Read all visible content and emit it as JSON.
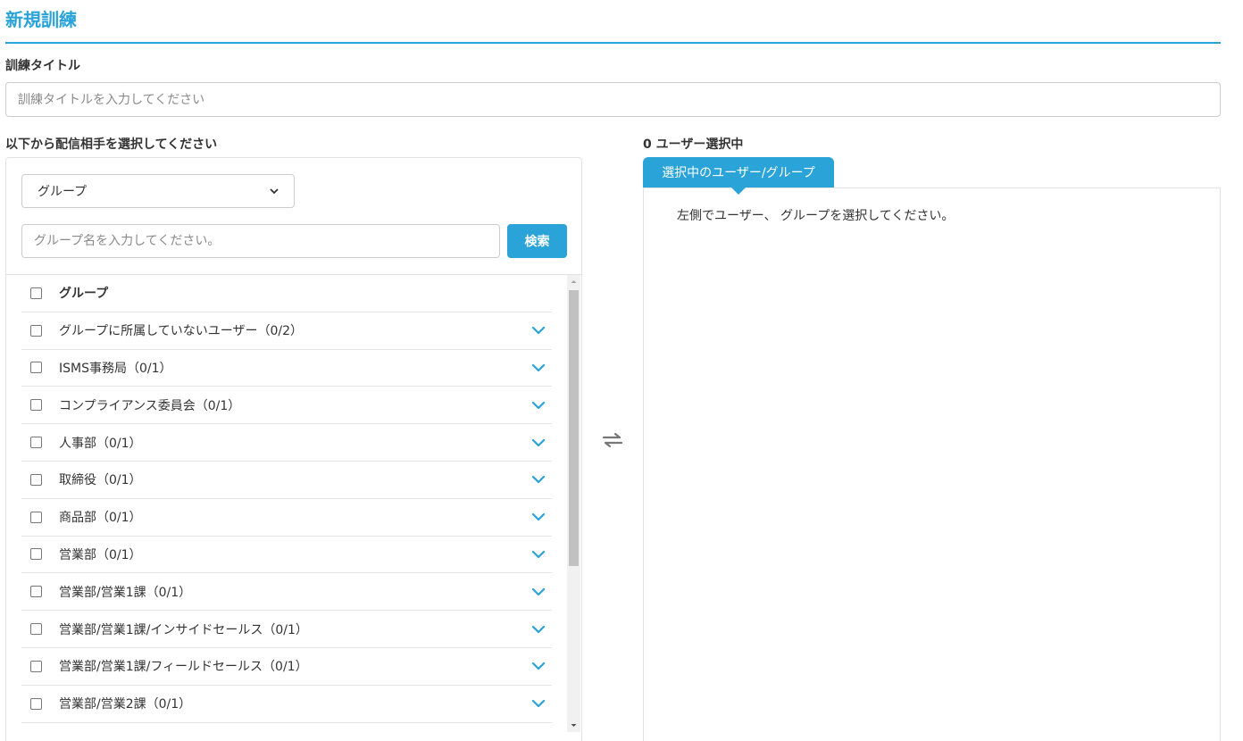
{
  "page": {
    "title": "新規訓練"
  },
  "title_field": {
    "label": "訓練タイトル",
    "placeholder": "訓練タイトルを入力してください"
  },
  "recipients": {
    "heading": "以下から配信相手を選択してください",
    "type_select": {
      "selected": "グループ"
    },
    "search": {
      "placeholder": "グループ名を入力してください。",
      "button_label": "検索"
    },
    "list_header": "グループ",
    "groups": [
      {
        "label": "グループに所属していないユーザー（0/2）"
      },
      {
        "label": "ISMS事務局（0/1）"
      },
      {
        "label": "コンプライアンス委員会（0/1）"
      },
      {
        "label": "人事部（0/1）"
      },
      {
        "label": "取締役（0/1）"
      },
      {
        "label": "商品部（0/1）"
      },
      {
        "label": "営業部（0/1）"
      },
      {
        "label": "営業部/営業1課（0/1）"
      },
      {
        "label": "営業部/営業1課/インサイドセールス（0/1）"
      },
      {
        "label": "営業部/営業1課/フィールドセールス（0/1）"
      },
      {
        "label": "営業部/営業2課（0/1）"
      }
    ]
  },
  "selection": {
    "count_text": "0 ユーザー選択中",
    "tab_label": "選択中のユーザー/グループ",
    "empty_message": "左側でユーザー、 グループを選択してください。"
  },
  "icons": {
    "swap": "swap-arrows-icon",
    "expand": "chevron-down-icon"
  },
  "colors": {
    "accent": "#2aa3d8"
  }
}
